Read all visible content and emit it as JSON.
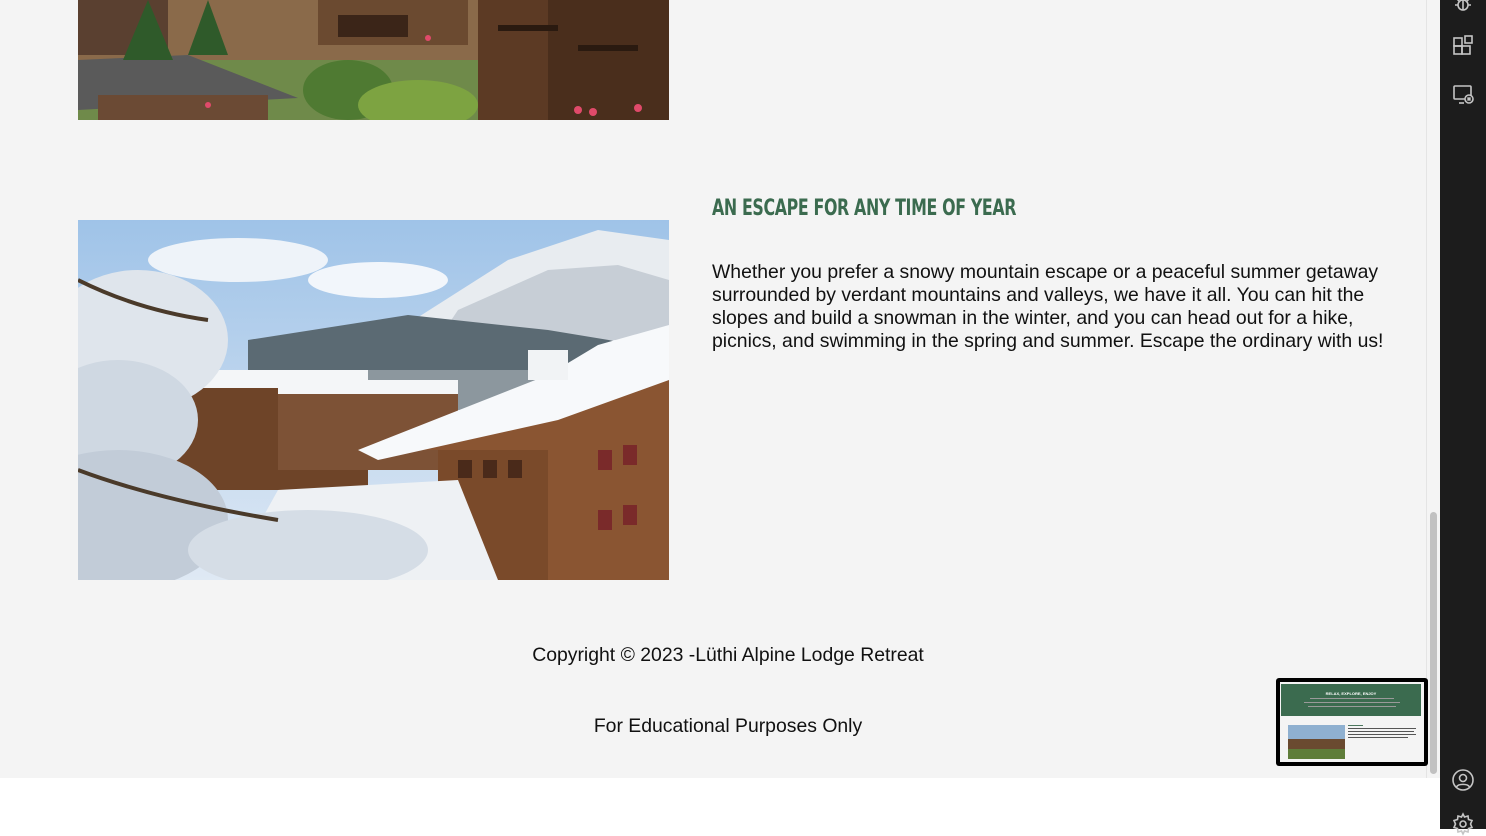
{
  "content": {
    "section_heading": "An Escape for Any Time of Year",
    "section_body": "Whether you prefer a snowy mountain escape or a peaceful summer getaway surrounded by verdant mountains and valleys, we have it all. You can hit the slopes and build a snowman in the winter, and you can head out for a hike, picnics, and swimming in the spring and summer. Escape the ordinary with us!"
  },
  "footer": {
    "copyright": "Copyright © 2023 -Lüthi Alpine Lodge Retreat",
    "note": "For Educational Purposes Only"
  },
  "preview": {
    "header_title": "RELAX, EXPLORE, ENJOY"
  },
  "activity_bar": {
    "icons": [
      "debug-icon",
      "extensions-icon",
      "remote-explorer-icon",
      "account-icon",
      "settings-gear-icon"
    ]
  },
  "colors": {
    "accent_green": "#3b6b4f",
    "page_background": "#f4f4f4",
    "activity_bar": "#1c1c1c"
  }
}
